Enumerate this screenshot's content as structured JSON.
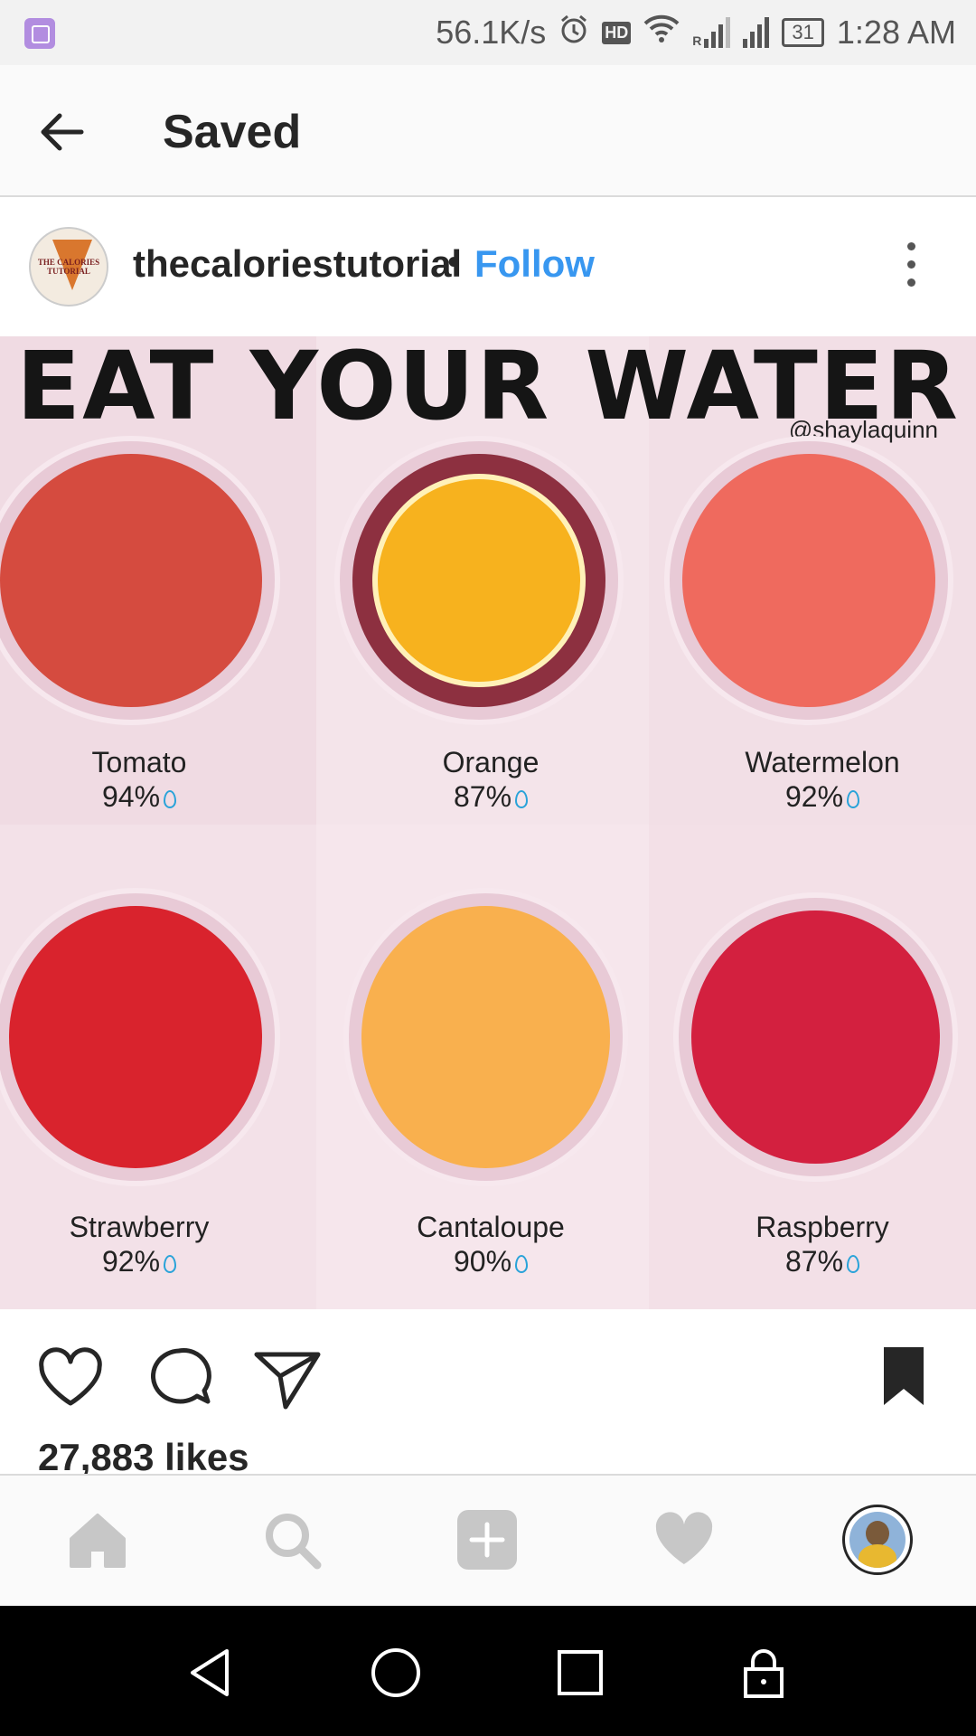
{
  "status_bar": {
    "speed": "56.1K/s",
    "hd": "HD",
    "network_label": "R",
    "battery": "31",
    "time": "1:28 AM"
  },
  "header": {
    "title": "Saved"
  },
  "post": {
    "username": "thecaloriestutorial",
    "separator": "•",
    "follow_label": "Follow",
    "avatar_text": "THE CALORIES TUTORIAL",
    "image": {
      "headline": "EAT YOUR WATER",
      "credit": "@shaylaquinn",
      "fruits": [
        {
          "name": "Tomato",
          "percent": "94%",
          "color": "#e85a4a"
        },
        {
          "name": "Orange",
          "percent": "87%",
          "color": "#f7b21e"
        },
        {
          "name": "Watermelon",
          "percent": "92%",
          "color": "#ef6a5e"
        },
        {
          "name": "Strawberry",
          "percent": "92%",
          "color": "#d9232d"
        },
        {
          "name": "Cantaloupe",
          "percent": "90%",
          "color": "#f9b04e"
        },
        {
          "name": "Raspberry",
          "percent": "87%",
          "color": "#d3203f"
        }
      ]
    },
    "likes": "27,883 likes"
  },
  "colors": {
    "accent": "#3897f0",
    "text": "#262626",
    "icon_gray": "#c7c7c7"
  }
}
